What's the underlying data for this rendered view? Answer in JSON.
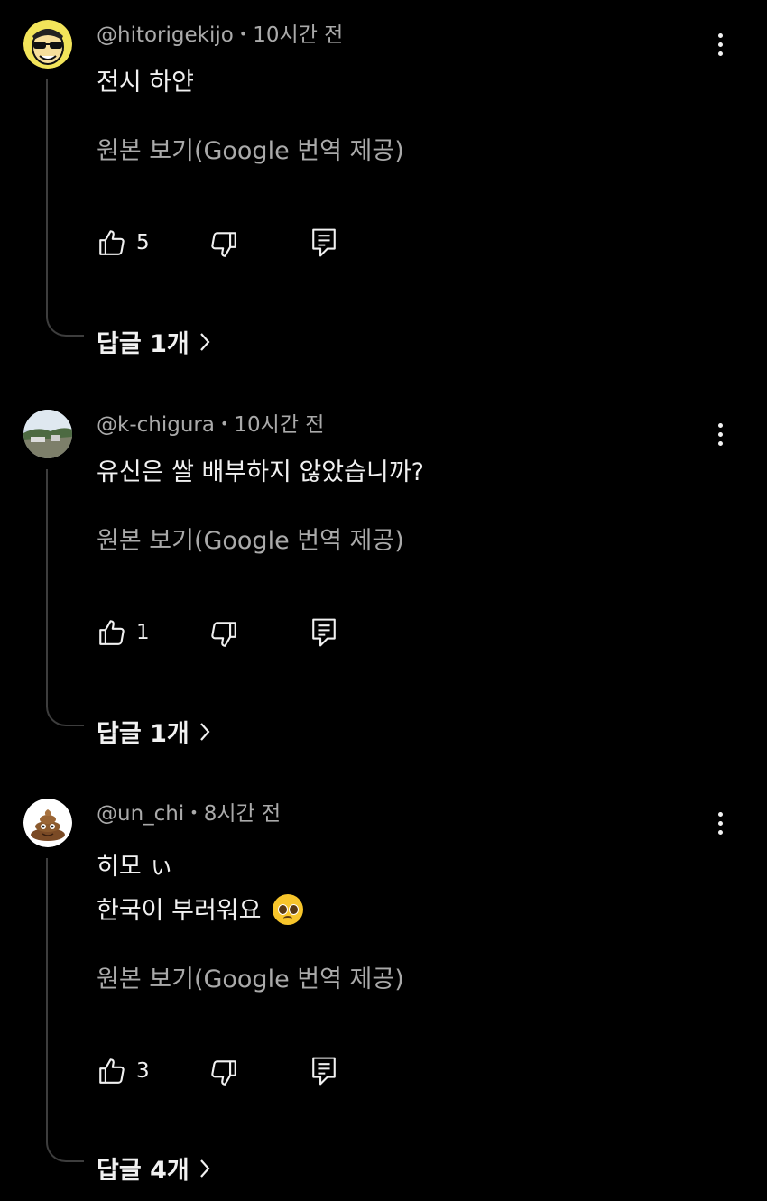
{
  "comments": [
    {
      "author": "@hitorigekijo",
      "separator": "•",
      "time": "10시간 전",
      "lines": [
        "전시 하얀"
      ],
      "translate_label": "원본 보기(Google 번역 제공)",
      "likes": "5",
      "replies_label": "답글 1개",
      "avatar_icon": "cartoon-sunglasses-avatar"
    },
    {
      "author": "@k-chigura",
      "separator": "•",
      "time": "10시간 전",
      "lines": [
        "유신은 쌀 배부하지 않았습니까?"
      ],
      "translate_label": "원본 보기(Google 번역 제공)",
      "likes": "1",
      "replies_label": "답글 1개",
      "avatar_icon": "landscape-photo-avatar"
    },
    {
      "author": "@un_chi",
      "separator": "•",
      "time": "8시간 전",
      "lines": [
        "히모 ぃ",
        "한국이 부러워요"
      ],
      "translate_label": "원본 보기(Google 번역 제공)",
      "likes": "3",
      "replies_label": "답글 4개",
      "avatar_icon": "poop-emoji-avatar",
      "emoji": "pleading-face-emoji"
    }
  ],
  "icons": {
    "like": "thumbs-up-icon",
    "dislike": "thumbs-down-icon",
    "reply": "reply-comment-icon",
    "more": "more-vertical-icon",
    "chevron": "chevron-right-icon"
  }
}
